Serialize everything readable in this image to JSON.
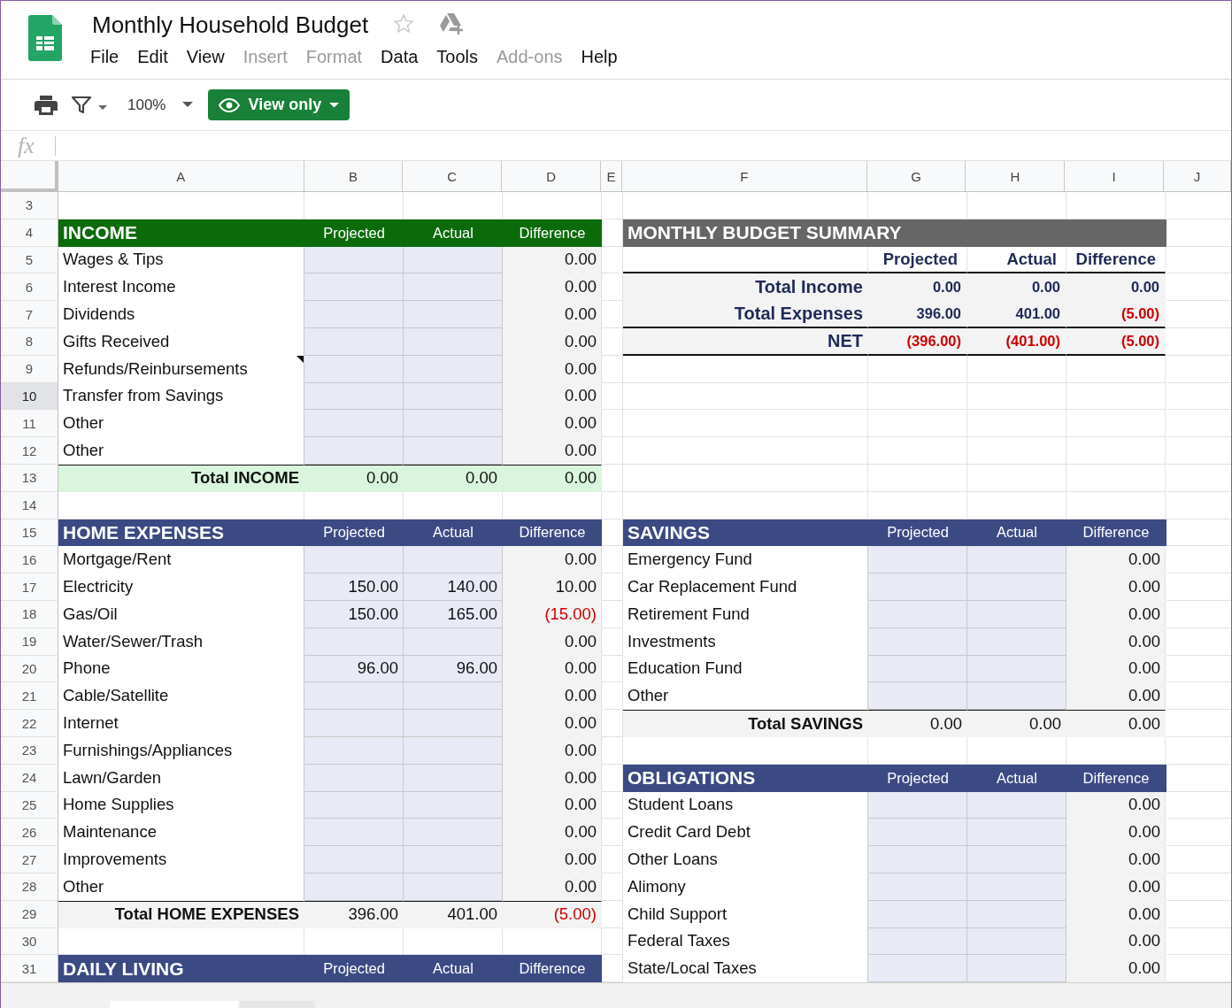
{
  "app": {
    "title": "Monthly Household Budget",
    "menu": [
      {
        "label": "File",
        "disabled": false
      },
      {
        "label": "Edit",
        "disabled": false
      },
      {
        "label": "View",
        "disabled": false
      },
      {
        "label": "Insert",
        "disabled": true
      },
      {
        "label": "Format",
        "disabled": true
      },
      {
        "label": "Data",
        "disabled": false
      },
      {
        "label": "Tools",
        "disabled": false
      },
      {
        "label": "Add-ons",
        "disabled": true
      },
      {
        "label": "Help",
        "disabled": false
      }
    ]
  },
  "toolbar": {
    "zoom": "100%",
    "mode_button": "View only"
  },
  "formula_bar": {
    "label": "fx"
  },
  "columns": [
    "A",
    "B",
    "C",
    "D",
    "E",
    "F",
    "G",
    "H",
    "I",
    "J"
  ],
  "row_numbers": [
    {
      "label": "3",
      "selected": false
    },
    {
      "label": "4",
      "selected": false
    },
    {
      "label": "5",
      "selected": false
    },
    {
      "label": "6",
      "selected": false
    },
    {
      "label": "7",
      "selected": false
    },
    {
      "label": "8",
      "selected": false
    },
    {
      "label": "9",
      "selected": false
    },
    {
      "label": "10",
      "selected": true
    },
    {
      "label": "11",
      "selected": false
    },
    {
      "label": "12",
      "selected": false
    },
    {
      "label": "13",
      "selected": false
    },
    {
      "label": "14",
      "selected": false
    },
    {
      "label": "15",
      "selected": false
    },
    {
      "label": "16",
      "selected": false
    },
    {
      "label": "17",
      "selected": false
    },
    {
      "label": "18",
      "selected": false
    },
    {
      "label": "19",
      "selected": false
    },
    {
      "label": "20",
      "selected": false
    },
    {
      "label": "21",
      "selected": false
    },
    {
      "label": "22",
      "selected": false
    },
    {
      "label": "23",
      "selected": false
    },
    {
      "label": "24",
      "selected": false
    },
    {
      "label": "25",
      "selected": false
    },
    {
      "label": "26",
      "selected": false
    },
    {
      "label": "27",
      "selected": false
    },
    {
      "label": "28",
      "selected": false
    },
    {
      "label": "29",
      "selected": false
    },
    {
      "label": "30",
      "selected": false
    },
    {
      "label": "31",
      "selected": false
    }
  ],
  "left_sections": [
    {
      "kind": "table",
      "title": "INCOME",
      "color": "#0b6b0b",
      "columns": [
        "Projected",
        "Actual",
        "Difference"
      ],
      "rows": [
        {
          "label": "Wages & Tips",
          "note": false,
          "cells": [
            null,
            null,
            {
              "value": "0.00",
              "negative": false
            }
          ]
        },
        {
          "label": "Interest Income",
          "note": false,
          "cells": [
            null,
            null,
            {
              "value": "0.00",
              "negative": false
            }
          ]
        },
        {
          "label": "Dividends",
          "note": false,
          "cells": [
            null,
            null,
            {
              "value": "0.00",
              "negative": false
            }
          ]
        },
        {
          "label": "Gifts Received",
          "note": false,
          "cells": [
            null,
            null,
            {
              "value": "0.00",
              "negative": false
            }
          ]
        },
        {
          "label": "Refunds/Reinbursements",
          "note": true,
          "cells": [
            null,
            null,
            {
              "value": "0.00",
              "negative": false
            }
          ]
        },
        {
          "label": "Transfer from Savings",
          "note": false,
          "cells": [
            null,
            null,
            {
              "value": "0.00",
              "negative": false
            }
          ]
        },
        {
          "label": "Other",
          "note": false,
          "cells": [
            null,
            null,
            {
              "value": "0.00",
              "negative": false
            }
          ]
        },
        {
          "label": "Other",
          "note": false,
          "cells": [
            null,
            null,
            {
              "value": "0.00",
              "negative": false
            }
          ]
        }
      ],
      "total": {
        "label": "Total INCOME",
        "color": "#d9f5dd",
        "cells": [
          {
            "value": "0.00",
            "negative": false
          },
          {
            "value": "0.00",
            "negative": false
          },
          {
            "value": "0.00",
            "negative": false
          }
        ]
      }
    },
    {
      "kind": "table",
      "title": "HOME EXPENSES",
      "color": "#3c4a84",
      "columns": [
        "Projected",
        "Actual",
        "Difference"
      ],
      "rows": [
        {
          "label": "Mortgage/Rent",
          "note": false,
          "cells": [
            null,
            null,
            {
              "value": "0.00",
              "negative": false
            }
          ]
        },
        {
          "label": "Electricity",
          "note": false,
          "cells": [
            {
              "value": "150.00",
              "negative": false
            },
            {
              "value": "140.00",
              "negative": false
            },
            {
              "value": "10.00",
              "negative": false
            }
          ]
        },
        {
          "label": "Gas/Oil",
          "note": false,
          "cells": [
            {
              "value": "150.00",
              "negative": false
            },
            {
              "value": "165.00",
              "negative": false
            },
            {
              "value": "(15.00)",
              "negative": true
            }
          ]
        },
        {
          "label": "Water/Sewer/Trash",
          "note": false,
          "cells": [
            null,
            null,
            {
              "value": "0.00",
              "negative": false
            }
          ]
        },
        {
          "label": "Phone",
          "note": false,
          "cells": [
            {
              "value": "96.00",
              "negative": false
            },
            {
              "value": "96.00",
              "negative": false
            },
            {
              "value": "0.00",
              "negative": false
            }
          ]
        },
        {
          "label": "Cable/Satellite",
          "note": false,
          "cells": [
            null,
            null,
            {
              "value": "0.00",
              "negative": false
            }
          ]
        },
        {
          "label": "Internet",
          "note": false,
          "cells": [
            null,
            null,
            {
              "value": "0.00",
              "negative": false
            }
          ]
        },
        {
          "label": "Furnishings/Appliances",
          "note": false,
          "cells": [
            null,
            null,
            {
              "value": "0.00",
              "negative": false
            }
          ]
        },
        {
          "label": "Lawn/Garden",
          "note": false,
          "cells": [
            null,
            null,
            {
              "value": "0.00",
              "negative": false
            }
          ]
        },
        {
          "label": "Home Supplies",
          "note": false,
          "cells": [
            null,
            null,
            {
              "value": "0.00",
              "negative": false
            }
          ]
        },
        {
          "label": "Maintenance",
          "note": false,
          "cells": [
            null,
            null,
            {
              "value": "0.00",
              "negative": false
            }
          ]
        },
        {
          "label": "Improvements",
          "note": false,
          "cells": [
            null,
            null,
            {
              "value": "0.00",
              "negative": false
            }
          ]
        },
        {
          "label": "Other",
          "note": false,
          "cells": [
            null,
            null,
            {
              "value": "0.00",
              "negative": false
            }
          ]
        }
      ],
      "total": {
        "label": "Total HOME EXPENSES",
        "color": "#f3f3f3",
        "cells": [
          {
            "value": "396.00",
            "negative": false
          },
          {
            "value": "401.00",
            "negative": false
          },
          {
            "value": "(5.00)",
            "negative": true
          }
        ]
      }
    },
    {
      "kind": "table",
      "title": "DAILY LIVING",
      "color": "#3c4a84",
      "columns": [
        "Projected",
        "Actual",
        "Difference"
      ]
    }
  ],
  "right_sections": [
    {
      "kind": "summary",
      "title": "MONTHLY BUDGET SUMMARY",
      "color": "#666666",
      "columns": [
        "Projected",
        "Actual",
        "Difference"
      ],
      "rows": [
        {
          "label": "Total Income",
          "cells": [
            {
              "value": "0.00",
              "negative": false
            },
            {
              "value": "0.00",
              "negative": false
            },
            {
              "value": "0.00",
              "negative": false
            }
          ]
        },
        {
          "label": "Total Expenses",
          "cells": [
            {
              "value": "396.00",
              "negative": false
            },
            {
              "value": "401.00",
              "negative": false
            },
            {
              "value": "(5.00)",
              "negative": true
            }
          ]
        },
        {
          "label": "NET",
          "cells": [
            {
              "value": "(396.00)",
              "negative": true
            },
            {
              "value": "(401.00)",
              "negative": true
            },
            {
              "value": "(5.00)",
              "negative": true
            }
          ]
        }
      ]
    },
    {
      "kind": "table",
      "title": "SAVINGS",
      "color": "#3c4a84",
      "columns": [
        "Projected",
        "Actual",
        "Difference"
      ],
      "rows": [
        {
          "label": "Emergency Fund",
          "note": false,
          "cells": [
            null,
            null,
            {
              "value": "0.00",
              "negative": false
            }
          ]
        },
        {
          "label": "Car Replacement Fund",
          "note": false,
          "cells": [
            null,
            null,
            {
              "value": "0.00",
              "negative": false
            }
          ]
        },
        {
          "label": "Retirement Fund",
          "note": false,
          "cells": [
            null,
            null,
            {
              "value": "0.00",
              "negative": false
            }
          ]
        },
        {
          "label": "Investments",
          "note": false,
          "cells": [
            null,
            null,
            {
              "value": "0.00",
              "negative": false
            }
          ]
        },
        {
          "label": "Education Fund",
          "note": false,
          "cells": [
            null,
            null,
            {
              "value": "0.00",
              "negative": false
            }
          ]
        },
        {
          "label": "Other",
          "note": false,
          "cells": [
            null,
            null,
            {
              "value": "0.00",
              "negative": false
            }
          ]
        }
      ],
      "total": {
        "label": "Total SAVINGS",
        "color": "#f3f3f3",
        "cells": [
          {
            "value": "0.00",
            "negative": false
          },
          {
            "value": "0.00",
            "negative": false
          },
          {
            "value": "0.00",
            "negative": false
          }
        ]
      }
    },
    {
      "kind": "table",
      "title": "OBLIGATIONS",
      "color": "#3c4a84",
      "columns": [
        "Projected",
        "Actual",
        "Difference"
      ],
      "rows": [
        {
          "label": "Student Loans",
          "note": false,
          "cells": [
            null,
            null,
            {
              "value": "0.00",
              "negative": false
            }
          ]
        },
        {
          "label": "Credit Card Debt",
          "note": false,
          "cells": [
            null,
            null,
            {
              "value": "0.00",
              "negative": false
            }
          ]
        },
        {
          "label": "Other Loans",
          "note": false,
          "cells": [
            null,
            null,
            {
              "value": "0.00",
              "negative": false
            }
          ]
        },
        {
          "label": "Alimony",
          "note": false,
          "cells": [
            null,
            null,
            {
              "value": "0.00",
              "negative": false
            }
          ]
        },
        {
          "label": "Child Support",
          "note": false,
          "cells": [
            null,
            null,
            {
              "value": "0.00",
              "negative": false
            }
          ]
        },
        {
          "label": "Federal Taxes",
          "note": false,
          "cells": [
            null,
            null,
            {
              "value": "0.00",
              "negative": false
            }
          ]
        },
        {
          "label": "State/Local Taxes",
          "note": false,
          "cells": [
            null,
            null,
            {
              "value": "0.00",
              "negative": false
            }
          ]
        }
      ]
    }
  ]
}
